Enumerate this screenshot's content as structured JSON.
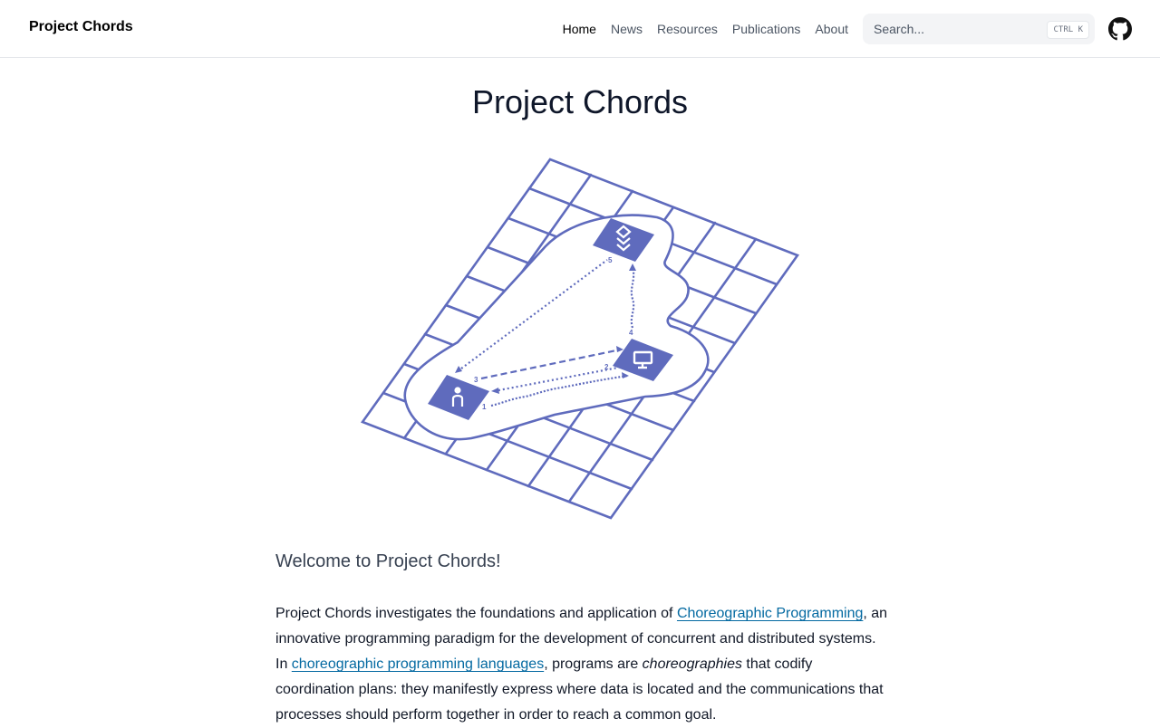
{
  "nav": {
    "brand": "Project Chords",
    "links": [
      {
        "label": "Home",
        "active": true
      },
      {
        "label": "News"
      },
      {
        "label": "Resources"
      },
      {
        "label": "Publications"
      },
      {
        "label": "About"
      }
    ],
    "search": {
      "placeholder": "Search...",
      "shortcut": "CTRL K"
    },
    "github_icon": "github-icon"
  },
  "page": {
    "title": "Project Chords",
    "subtitle": "Welcome to Project Chords!",
    "intro": {
      "t1": "Project Chords investigates the foundations and application of ",
      "link1": "Choreographic Programming",
      "t2": ", an innovative programming paradigm for the development of concurrent and distributed systems. In ",
      "link2": "choreographic programming languages",
      "t3": ", programs are ",
      "em": "choreographies",
      "t4": " that codify coordination plans: they manifestly express where data is located and the communications that processes should perform together in order to reach a common goal."
    }
  },
  "illustration": {
    "labels": [
      "1",
      "2",
      "3",
      "4",
      "5"
    ],
    "icons": [
      "person-icon",
      "computer-icon",
      "database-icon"
    ]
  },
  "colors": {
    "accent": "#5f6bbd",
    "link": "#0369a1"
  }
}
